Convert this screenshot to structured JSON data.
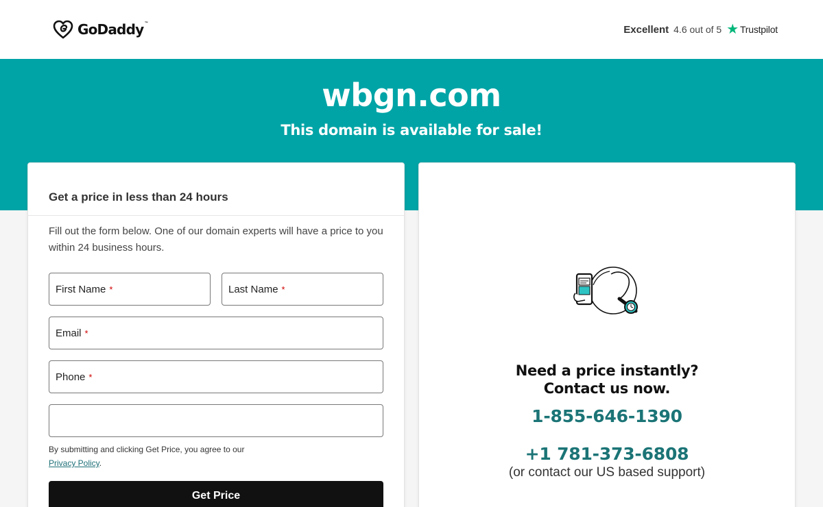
{
  "header": {
    "logo_text": "GoDaddy",
    "logo_tm": "™",
    "trust_rating_word": "Excellent",
    "trust_score": "4.6 out of 5",
    "trust_brand": "Trustpilot",
    "trust_star_color": "#00b67a"
  },
  "hero": {
    "domain": "wbgn.com",
    "subtitle": "This domain is available for sale!",
    "background_color": "#00a4a6"
  },
  "form": {
    "title": "Get a price in less than 24 hours",
    "description": "Fill out the form below. One of our domain experts will have a price to you within 24 business hours.",
    "fields": {
      "first_name": {
        "label": "First Name",
        "required_mark": "*",
        "value": ""
      },
      "last_name": {
        "label": "Last Name",
        "required_mark": "*",
        "value": ""
      },
      "email": {
        "label": "Email",
        "required_mark": "*",
        "value": ""
      },
      "phone": {
        "label": "Phone",
        "required_mark": "*",
        "value": ""
      },
      "extra": {
        "label": "",
        "value": ""
      }
    },
    "consent_text": "By submitting and clicking Get Price, you agree to our",
    "privacy_link": "Privacy Policy",
    "consent_end": ".",
    "submit_label": "Get Price"
  },
  "contact": {
    "title_line1": "Need a price instantly?",
    "title_line2": "Contact us now.",
    "phone_primary": "1-855-646-1390",
    "phone_secondary": "+1 781-373-6808",
    "support_note": "(or contact our US based support)",
    "phone_color": "#1b7476"
  }
}
